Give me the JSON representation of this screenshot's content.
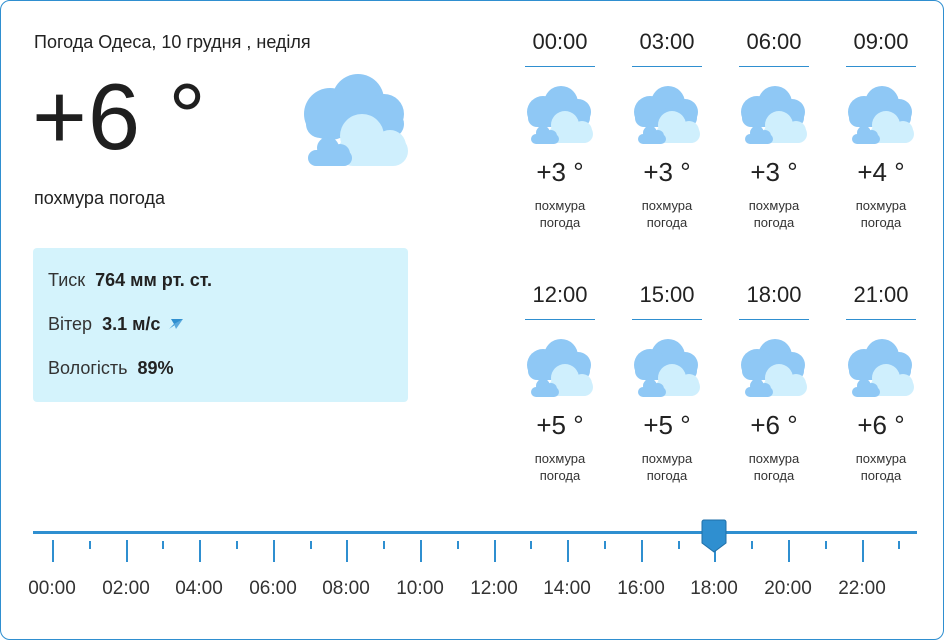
{
  "header": {
    "title": "Погода Одеса, 10 грудня , неділя"
  },
  "current": {
    "temp": "+6 °",
    "condition": "похмура погода",
    "icon": "cloudy-icon"
  },
  "details": {
    "pressure_label": "Тиск",
    "pressure_value": "764 мм рт. ст.",
    "wind_label": "Вітер",
    "wind_value": "3.1 м/с",
    "wind_icon": "wind-direction-arrow-icon",
    "humidity_label": "Вологість",
    "humidity_value": "89%"
  },
  "hourly": [
    {
      "time": "00:00",
      "temp": "+3 °",
      "cond1": "похмура",
      "cond2": "погода"
    },
    {
      "time": "03:00",
      "temp": "+3 °",
      "cond1": "похмура",
      "cond2": "погода"
    },
    {
      "time": "06:00",
      "temp": "+3 °",
      "cond1": "похмура",
      "cond2": "погода"
    },
    {
      "time": "09:00",
      "temp": "+4 °",
      "cond1": "похмура",
      "cond2": "погода"
    },
    {
      "time": "12:00",
      "temp": "+5 °",
      "cond1": "похмура",
      "cond2": "погода"
    },
    {
      "time": "15:00",
      "temp": "+5 °",
      "cond1": "похмура",
      "cond2": "погода"
    },
    {
      "time": "18:00",
      "temp": "+6 °",
      "cond1": "похмура",
      "cond2": "погода"
    },
    {
      "time": "21:00",
      "temp": "+6 °",
      "cond1": "похмура",
      "cond2": "погода"
    }
  ],
  "timeline": {
    "labels": [
      "00:00",
      "02:00",
      "04:00",
      "06:00",
      "08:00",
      "10:00",
      "12:00",
      "14:00",
      "16:00",
      "18:00",
      "20:00",
      "22:00"
    ],
    "selected": "18:00",
    "color": "#2f8fd0"
  },
  "colors": {
    "accent": "#2f8fd0",
    "info_bg": "#d4f3fc",
    "cloud_back": "#8fc8f5",
    "cloud_front": "#cfeffd"
  }
}
